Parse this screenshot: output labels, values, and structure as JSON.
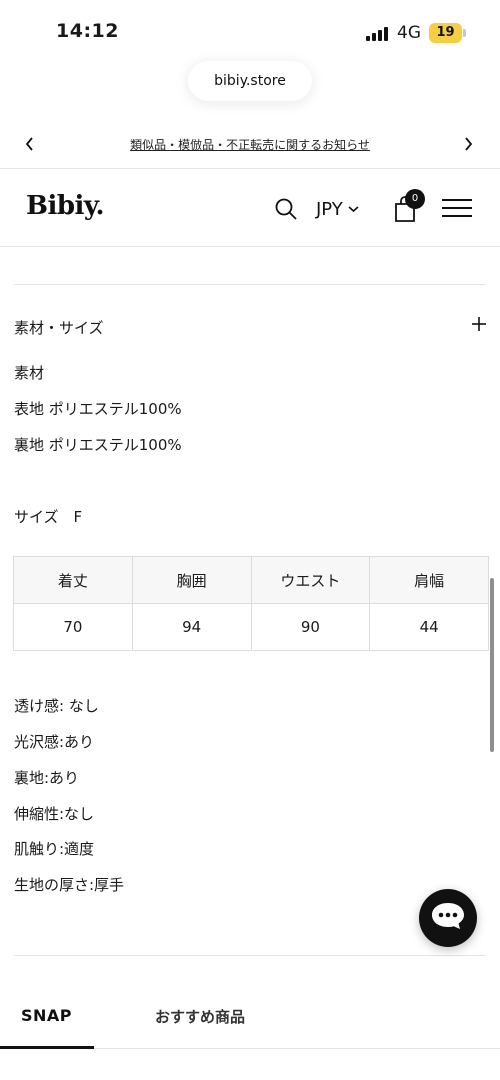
{
  "status_bar": {
    "time": "14:12",
    "network": "4G",
    "battery": "19",
    "battery_color": "#f5cf3f"
  },
  "browser": {
    "url": "bibiy.store"
  },
  "announcement": {
    "text": "類似品・模倣品・不正転売に関するお知らせ",
    "prev_icon": "chevron-left-icon",
    "next_icon": "chevron-right-icon"
  },
  "header": {
    "logo": "Bibiy.",
    "currency": "JPY",
    "cart_count": "0",
    "icons": [
      "search-icon",
      "chevron-down-icon",
      "shopping-bag-icon",
      "hamburger-menu-icon"
    ]
  },
  "accordion": {
    "title": "素材・サイズ",
    "toggle_icon": "plus-icon"
  },
  "material": {
    "heading": "素材",
    "lines": [
      "表地 ポリエステル100%",
      "裏地 ポリエステル100%"
    ]
  },
  "size_label": "サイズ　F",
  "size_table": {
    "headers": [
      "着丈",
      "胸囲",
      "ウエスト",
      "肩幅"
    ],
    "rows": [
      [
        "70",
        "94",
        "90",
        "44"
      ]
    ]
  },
  "properties": [
    "透け感: なし",
    "光沢感:あり",
    "裏地:あり",
    "伸縮性:なし",
    "肌触り:適度",
    "生地の厚さ:厚手"
  ],
  "chat": {
    "icon": "chat-bubble-icon",
    "color": "#111111"
  },
  "tabs": [
    {
      "label": "SNAP",
      "active": true
    },
    {
      "label": "おすすめ商品",
      "active": false
    }
  ]
}
